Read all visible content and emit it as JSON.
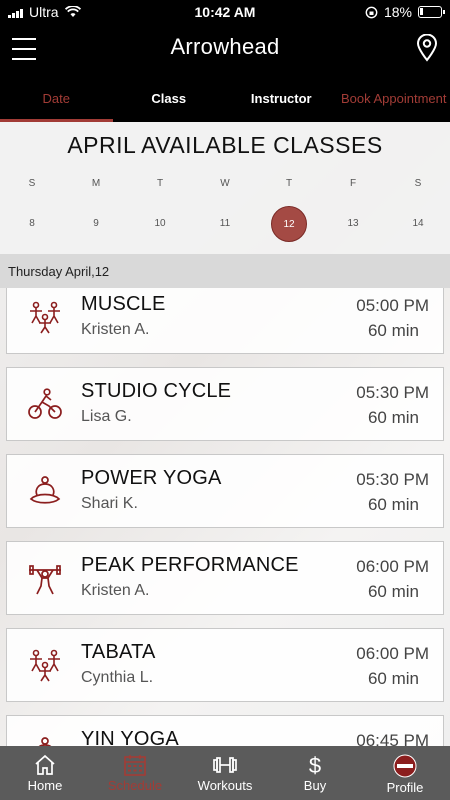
{
  "status": {
    "carrier": "Ultra",
    "time": "10:42 AM",
    "battery": "18%",
    "battery_level": 0.18
  },
  "header": {
    "title": "Arrowhead",
    "menu_icon": "hamburger-menu-icon",
    "location_icon": "map-pin-icon"
  },
  "tabs": [
    {
      "label": "Date",
      "active": true
    },
    {
      "label": "Class",
      "active": false
    },
    {
      "label": "Instructor",
      "active": false
    },
    {
      "label": "Book Appointment",
      "active": false
    }
  ],
  "calendar": {
    "month_title": "APRIL AVAILABLE CLASSES",
    "weekdays": [
      "S",
      "M",
      "T",
      "W",
      "T",
      "F",
      "S"
    ],
    "dates": [
      "8",
      "9",
      "10",
      "11",
      "12",
      "13",
      "14"
    ],
    "selected": "12"
  },
  "day_header": "Thursday April,12",
  "classes": [
    {
      "name": "MUSCLE",
      "instructor": "Kristen A.",
      "time": "05:00 PM",
      "duration": "60 min",
      "icon": "group-fitness-icon"
    },
    {
      "name": "STUDIO CYCLE",
      "instructor": "Lisa G.",
      "time": "05:30 PM",
      "duration": "60 min",
      "icon": "cycling-icon"
    },
    {
      "name": "POWER YOGA",
      "instructor": "Shari K.",
      "time": "05:30 PM",
      "duration": "60 min",
      "icon": "yoga-icon"
    },
    {
      "name": "PEAK PERFORMANCE",
      "instructor": "Kristen A.",
      "time": "06:00 PM",
      "duration": "60 min",
      "icon": "weightlifting-icon"
    },
    {
      "name": "TABATA",
      "instructor": "Cynthia L.",
      "time": "06:00 PM",
      "duration": "60 min",
      "icon": "group-fitness-icon"
    },
    {
      "name": "YIN YOGA",
      "instructor": "",
      "time": "06:45 PM",
      "duration": "",
      "icon": "yoga-icon"
    }
  ],
  "bottom_nav": [
    {
      "label": "Home",
      "icon": "home-icon",
      "active": false
    },
    {
      "label": "Schedule",
      "icon": "calendar-icon",
      "active": true
    },
    {
      "label": "Workouts",
      "icon": "dumbbell-icon",
      "active": false
    },
    {
      "label": "Buy",
      "icon": "dollar-icon",
      "active": false
    },
    {
      "label": "Profile",
      "icon": "profile-avatar-icon",
      "active": false
    }
  ],
  "colors": {
    "accent": "#a23c36",
    "nav_bg": "#5b5b5b",
    "header_bg": "#000000"
  }
}
